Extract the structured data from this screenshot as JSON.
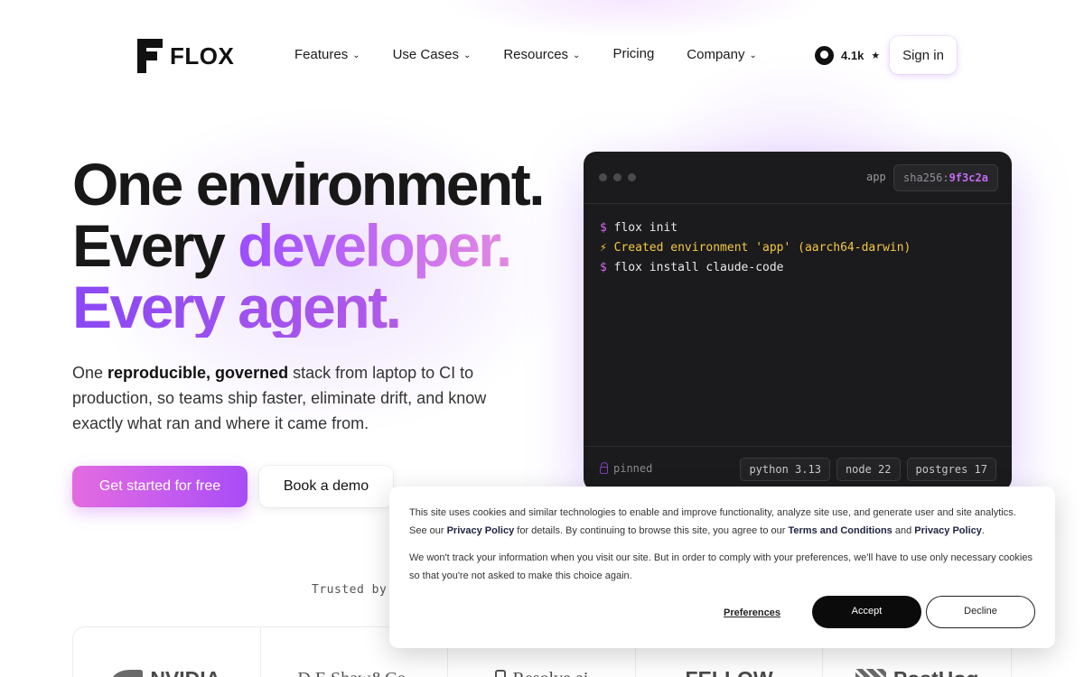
{
  "brand": {
    "name": "FLOX"
  },
  "nav": {
    "items": [
      {
        "label": "Features",
        "has_menu": true
      },
      {
        "label": "Use Cases",
        "has_menu": true
      },
      {
        "label": "Resources",
        "has_menu": true
      },
      {
        "label": "Pricing",
        "has_menu": false
      },
      {
        "label": "Company",
        "has_menu": true
      }
    ],
    "github_stars": "4.1k",
    "star_glyph": "★",
    "signin_label": "Sign in"
  },
  "hero": {
    "line1": "One environment.",
    "line2_a": "Every ",
    "line2_b": "developer.",
    "line3": "Every agent.",
    "sub_a": "One ",
    "sub_b": "reproducible, governed",
    "sub_c": " stack from laptop to CI to production, so teams ship faster, eliminate drift, and know exactly what ran and where it came from.",
    "cta_primary": "Get started for free",
    "cta_secondary": "Book a demo"
  },
  "terminal": {
    "app_label": "app",
    "sha_prefix": "sha256:",
    "sha_hash": "9f3c2a",
    "lines": [
      {
        "prefix": "$",
        "text": "flox init"
      },
      {
        "prefix": "⚡",
        "text": "Created environment 'app' (aarch64-darwin)"
      },
      {
        "prefix": "$",
        "text": "flox install claude-code"
      }
    ],
    "pinned_label": "pinned",
    "packages": [
      "python 3.13",
      "node 22",
      "postgres 17"
    ]
  },
  "trusted": {
    "label": "Trusted by l",
    "logos": [
      "NVIDIA",
      "D.E.Shaw&Co.",
      "Resolve.ai",
      "FELLOW",
      "PostHog"
    ]
  },
  "cookie": {
    "p1_a": "This site uses cookies and similar technologies to enable and improve functionality, analyze site use, and generate user and site analytics. See our ",
    "p1_link1": "Privacy Policy",
    "p1_b": " for details. By continuing to browse this site, you agree to our ",
    "p1_link2": "Terms and Conditions",
    "p1_c": " and ",
    "p1_link3": "Privacy Policy",
    "p1_d": ".",
    "p2": "We won't track your information when you visit our site. But in order to comply with your preferences, we'll have to use only necessary cookies so that you're not asked to make this choice again.",
    "preferences_label": "Preferences",
    "accept_label": "Accept",
    "decline_label": "Decline"
  },
  "colors": {
    "accent_purple": "#a74cf5",
    "accent_pink": "#e36be0",
    "terminal_bg": "#1b1b1d",
    "terminal_yellow": "#f3c843"
  }
}
